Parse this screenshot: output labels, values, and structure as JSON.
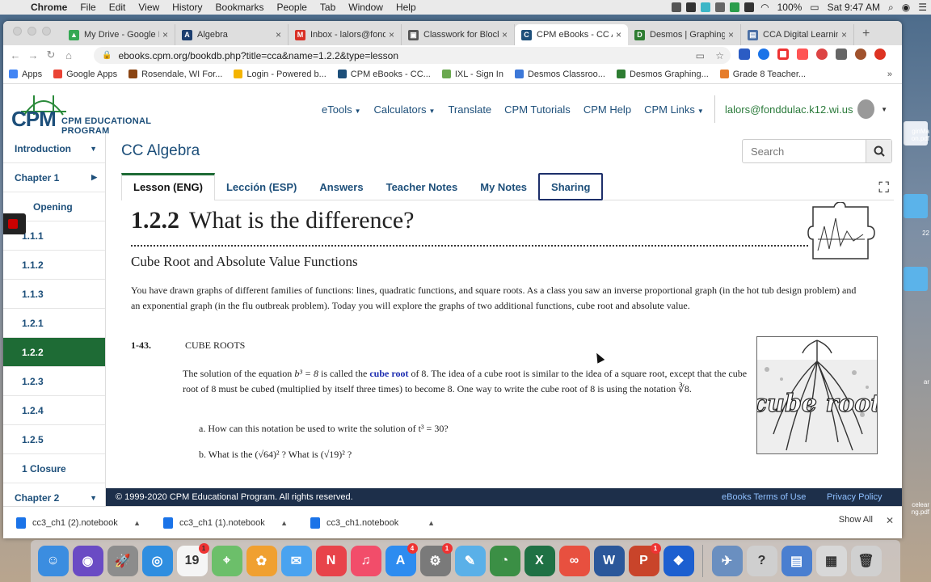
{
  "menubar": {
    "app": "Chrome",
    "items": [
      "File",
      "Edit",
      "View",
      "History",
      "Bookmarks",
      "People",
      "Tab",
      "Window",
      "Help"
    ],
    "battery": "100%",
    "clock": "Sat 9:47 AM"
  },
  "browser": {
    "tabs": [
      {
        "title": "My Drive - Google Drive",
        "color": "#34a853",
        "glyph": "▲"
      },
      {
        "title": "Algebra",
        "color": "#1d3e6e",
        "glyph": "A"
      },
      {
        "title": "Inbox - lalors@fonddulac",
        "color": "#d93025",
        "glyph": "M"
      },
      {
        "title": "Classwork for Block",
        "color": "#555555",
        "glyph": "▣"
      },
      {
        "title": "CPM eBooks - CC Algebra",
        "color": "#1d4f7a",
        "glyph": "C"
      },
      {
        "title": "Desmos | Graphing Calculator",
        "color": "#2e7d32",
        "glyph": "D"
      },
      {
        "title": "CCA Digital Learning",
        "color": "#4a6fa5",
        "glyph": "▤"
      }
    ],
    "active_tab": 4,
    "url": "ebooks.cpm.org/bookdb.php?title=cca&name=1.2.2&type=lesson",
    "bookmarks": [
      {
        "label": "Apps",
        "color": "#4285f4"
      },
      {
        "label": "Google Apps",
        "color": "#ea4335"
      },
      {
        "label": "Rosendale, WI For...",
        "color": "#8b4513"
      },
      {
        "label": "Login - Powered b...",
        "color": "#f4b400"
      },
      {
        "label": "CPM eBooks - CC...",
        "color": "#1d4f7a"
      },
      {
        "label": "IXL - Sign In",
        "color": "#6aa84f"
      },
      {
        "label": "Desmos Classroo...",
        "color": "#3c78d8"
      },
      {
        "label": "Desmos Graphing...",
        "color": "#2e7d32"
      },
      {
        "label": "Grade 8 Teacher...",
        "color": "#e67c2a"
      }
    ]
  },
  "site": {
    "logo_big": "CPM",
    "logo_small": "CPM EDUCATIONAL PROGRAM",
    "nav": [
      {
        "label": "eTools",
        "dropdown": true
      },
      {
        "label": "Calculators",
        "dropdown": true
      },
      {
        "label": "Translate",
        "dropdown": false
      },
      {
        "label": "CPM Tutorials",
        "dropdown": false
      },
      {
        "label": "CPM Help",
        "dropdown": false
      },
      {
        "label": "CPM Links",
        "dropdown": true
      }
    ],
    "user": "lalors@fonddulac.k12.wi.us"
  },
  "sidebar": {
    "items": [
      {
        "label": "Introduction",
        "kind": "chap",
        "chev": "▼"
      },
      {
        "label": "Chapter 1",
        "kind": "chap",
        "chev": "▶"
      },
      {
        "label": "Opening",
        "kind": "sub",
        "chev": ""
      },
      {
        "label": "1.1.1",
        "kind": "sub",
        "chev": ""
      },
      {
        "label": "1.1.2",
        "kind": "sub",
        "chev": ""
      },
      {
        "label": "1.1.3",
        "kind": "sub",
        "chev": ""
      },
      {
        "label": "1.2.1",
        "kind": "sub",
        "chev": ""
      },
      {
        "label": "1.2.2",
        "kind": "sub",
        "chev": "",
        "active": true
      },
      {
        "label": "1.2.3",
        "kind": "sub",
        "chev": ""
      },
      {
        "label": "1.2.4",
        "kind": "sub",
        "chev": ""
      },
      {
        "label": "1.2.5",
        "kind": "sub",
        "chev": ""
      },
      {
        "label": "1 Closure",
        "kind": "sub",
        "chev": ""
      },
      {
        "label": "Chapter 2",
        "kind": "chap",
        "chev": "▼"
      }
    ]
  },
  "main": {
    "book_title": "CC Algebra",
    "search_placeholder": "Search",
    "tabs": [
      "Lesson (ENG)",
      "Lección (ESP)",
      "Answers",
      "Teacher Notes",
      "My Notes",
      "Sharing"
    ],
    "lesson_num": "1.2.2",
    "lesson_title": "What is the difference?",
    "subtitle": "Cube Root and Absolute Value Functions",
    "intro": "You have drawn graphs of different families of functions: lines, quadratic functions, and square roots.  As a class you saw an inverse proportional graph (in the hot tub design problem) and an exponential graph (in the flu outbreak problem).  Today you will explore the graphs of two additional functions, cube root and absolute value.",
    "problem_num": "1-43.",
    "problem_title": "CUBE ROOTS",
    "para_a": "The solution of the equation ",
    "para_eq": "b³ = 8",
    "para_b": " is called the ",
    "para_kw": "cube root",
    "para_c": " of 8.  The idea of a cube root is similar to the idea of a square root, except that the cube root of 8 must be cubed (multiplied by itself three times) to become 8.  One way to write the cube root of 8 is using the notation ",
    "para_notation": "∛8.",
    "qa": "a. How can this notation be used to write the solution of  t³ = 30?",
    "qb": "b. What is the (√64)² ?  What  is (√19)² ?",
    "cube_img_text": "cube root"
  },
  "footer": {
    "copyright": "© 1999-2020 CPM Educational Program. All rights reserved.",
    "terms": "eBooks Terms of Use",
    "privacy": "Privacy Policy"
  },
  "downloads": {
    "files": [
      "cc3_ch1 (2).notebook",
      "cc3_ch1 (1).notebook",
      "cc3_ch1.notebook"
    ],
    "show_all": "Show All"
  },
  "desktop_labels": [
    "ginMa on.pdf",
    "22",
    "ar",
    "celear ng.pdf"
  ],
  "dock": [
    {
      "name": "finder-icon",
      "color": "#3b8de0",
      "glyph": "☺",
      "badge": ""
    },
    {
      "name": "siri-icon",
      "color": "#6a4bc4",
      "glyph": "◉",
      "badge": ""
    },
    {
      "name": "launchpad-icon",
      "color": "#8c8c8c",
      "glyph": "🚀",
      "badge": ""
    },
    {
      "name": "safari-icon",
      "color": "#2f8ee0",
      "glyph": "◎",
      "badge": ""
    },
    {
      "name": "calendar-icon",
      "color": "#f5f5f5",
      "glyph": "19",
      "badge": "1"
    },
    {
      "name": "maps-icon",
      "color": "#6cbf6a",
      "glyph": "⌖",
      "badge": ""
    },
    {
      "name": "photos-icon",
      "color": "#f0a030",
      "glyph": "✿",
      "badge": ""
    },
    {
      "name": "messages-icon",
      "color": "#4aa3f0",
      "glyph": "✉",
      "badge": ""
    },
    {
      "name": "news-icon",
      "color": "#e8434a",
      "glyph": "N",
      "badge": ""
    },
    {
      "name": "music-icon",
      "color": "#f24d6a",
      "glyph": "♫",
      "badge": ""
    },
    {
      "name": "appstore-icon",
      "color": "#2d8cf0",
      "glyph": "A",
      "badge": "4"
    },
    {
      "name": "system-preferences-icon",
      "color": "#7a7a7a",
      "glyph": "⚙",
      "badge": "1"
    },
    {
      "name": "notes-icon",
      "color": "#5ab0e8",
      "glyph": "✎",
      "badge": ""
    },
    {
      "name": "chrome-icon",
      "color": "#3b8f45",
      "glyph": "◔",
      "badge": ""
    },
    {
      "name": "excel-icon",
      "color": "#1f7144",
      "glyph": "X",
      "badge": ""
    },
    {
      "name": "creative-cloud-icon",
      "color": "#e8503f",
      "glyph": "∞",
      "badge": ""
    },
    {
      "name": "word-icon",
      "color": "#2b579a",
      "glyph": "W",
      "badge": ""
    },
    {
      "name": "powerpoint-icon",
      "color": "#c9442a",
      "glyph": "P",
      "badge": "1"
    },
    {
      "name": "dropbox-icon",
      "color": "#1c5fd0",
      "glyph": "❖",
      "badge": ""
    },
    {
      "name": "preview-icon",
      "color": "#6a8fc0",
      "glyph": "✈",
      "badge": ""
    },
    {
      "name": "help-icon",
      "color": "#cfcfcf",
      "glyph": "?",
      "badge": ""
    },
    {
      "name": "documents-icon",
      "color": "#4a7fd0",
      "glyph": "▤",
      "badge": ""
    },
    {
      "name": "downloads-icon",
      "color": "#d8d8d8",
      "glyph": "▦",
      "badge": ""
    },
    {
      "name": "trash-icon",
      "color": "#d0d0d0",
      "glyph": "🗑",
      "badge": ""
    }
  ]
}
